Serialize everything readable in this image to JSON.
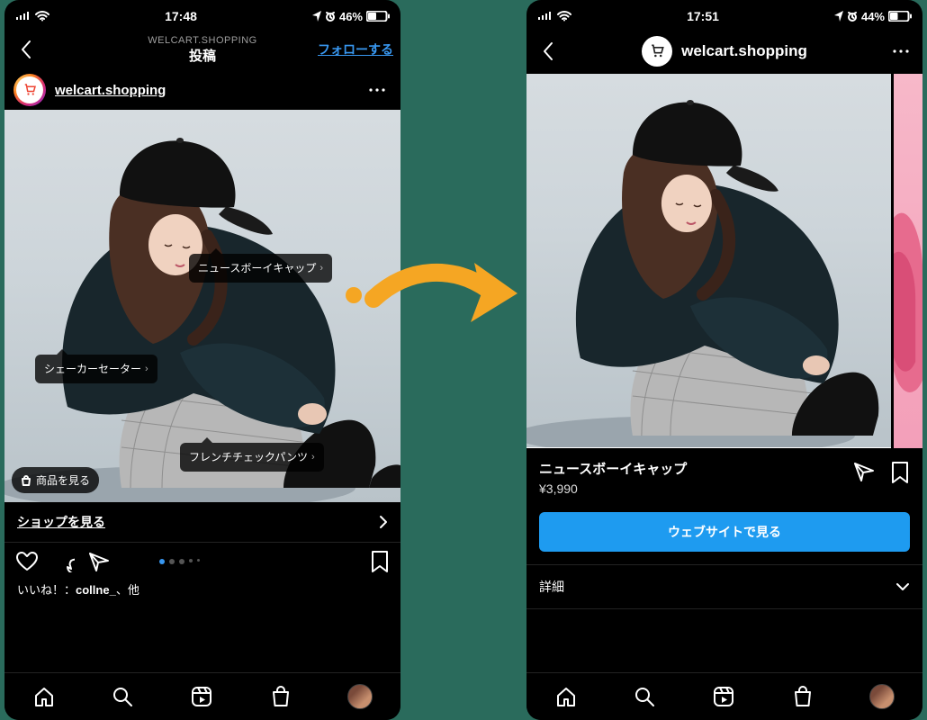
{
  "left": {
    "status": {
      "time": "17:48",
      "battery": "46%"
    },
    "nav": {
      "sub": "WELCART.SHOPPING",
      "title": "投稿",
      "follow": "フォローする"
    },
    "account": "welcart.shopping",
    "tags": {
      "cap": "ニュースボーイキャップ",
      "sweater": "シェーカーセーター",
      "pants": "フレンチチェックパンツ"
    },
    "pill": "商品を見る",
    "shoprow": "ショップを見る",
    "likes_prefix": "いいね！：",
    "likes_user": "collne_",
    "likes_suffix": "、他"
  },
  "right": {
    "status": {
      "time": "17:51",
      "battery": "44%"
    },
    "account": "welcart.shopping",
    "product": {
      "title": "ニュースボーイキャップ",
      "price": "¥3,990"
    },
    "cta": "ウェブサイトで見る",
    "detail": "詳細"
  }
}
